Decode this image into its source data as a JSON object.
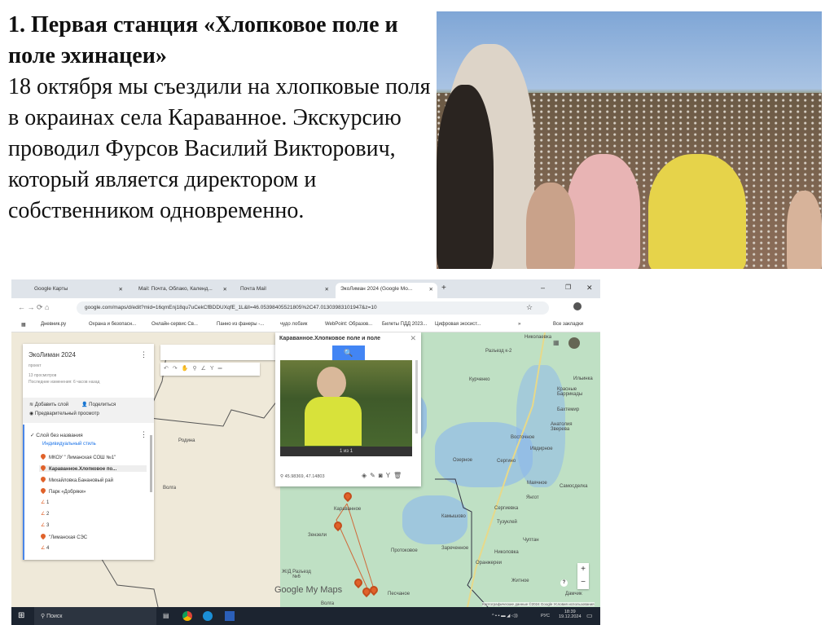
{
  "slide": {
    "title": "1. Первая станция «Хлопковое поле и поле эхинацеи»",
    "body": "18 октября мы съездили на хлопковые поля в окраинах села Караванное. Экскурсию проводил Фурсов Василий Викторович, который является директором и собственником одновременно."
  },
  "browser": {
    "tabs": [
      {
        "label": "Google Карты"
      },
      {
        "label": "Mail: Почта, Облако, Календ..."
      },
      {
        "label": "Почта Mail"
      },
      {
        "label": "ЭкоЛиман 2024 (Google Мо..."
      }
    ],
    "url": "google.com/maps/d/edit?mid=16qmEnj18qu7uCekCfBDDUXqfE_1L&ll=46.05398405521805%2C47.01303983101947&z=10",
    "bookmarks": [
      "Дневник.ру",
      "Охрана и безопасн...",
      "Онлайн-сервис Св...",
      "Панно из фанеры -...",
      "чудо лобзик",
      "WebPoint: Образов...",
      "Билеты ПДД 2023...",
      "Цифровая экосист...",
      "»",
      "Все закладки"
    ]
  },
  "mymaps": {
    "title": "ЭкоЛиман 2024",
    "subtitle": "проект",
    "views": "13 просмотров",
    "last_change": "Последние изменения: 6 часов назад",
    "add_layer": "Добавить слой",
    "share": "Поделиться",
    "preview": "Предварительный просмотр",
    "layer_name": "Слой без названия",
    "style": "Индивидуальный стиль",
    "items": [
      {
        "label": "МКОУ \" Лиманская СОШ №1\"",
        "type": "pin"
      },
      {
        "label": "Караванное.Хлопковое по...",
        "type": "pin"
      },
      {
        "label": "Михайловка.Банановый рай",
        "type": "pin"
      },
      {
        "label": "Парк «Добряки»",
        "type": "pin"
      },
      {
        "label": "1",
        "type": "route"
      },
      {
        "label": "2",
        "type": "route"
      },
      {
        "label": "3",
        "type": "route"
      },
      {
        "label": "\"Лиманская СЭС",
        "type": "pin"
      },
      {
        "label": "4",
        "type": "route"
      }
    ],
    "popup": {
      "title": "Караванное.Хлопковое поле и поле",
      "counter": "1 из 1",
      "coords": "45.98369, 47.14803"
    },
    "labels": [
      "Родина",
      "Волга",
      "Николаевка",
      "Разъезд к-2",
      "Курченко",
      "Ильинка",
      "Красные Баррикады",
      "Бахтемир",
      "Анатолия Зверева",
      "Восточное",
      "Ивдирное",
      "Озерное",
      "Сергино",
      "Маячное",
      "Самосделка",
      "Янгот",
      "Сергиевка",
      "Камышово",
      "Тузуклей",
      "Чуптан",
      "Зареченное",
      "Николовка",
      "Оранжереи",
      "Житное",
      "Дамчик",
      "Зензели",
      "Караванное",
      "Протоковое",
      "Ж/Д Разъезд №6",
      "Песчаное",
      "Волга"
    ],
    "brand": "Google My Maps",
    "attribution": "Картографические данные ©2024 Google   Условия использования"
  },
  "taskbar": {
    "search": "Поиск",
    "lang": "РУС",
    "time": "18:39",
    "date": "19.12.2024"
  }
}
